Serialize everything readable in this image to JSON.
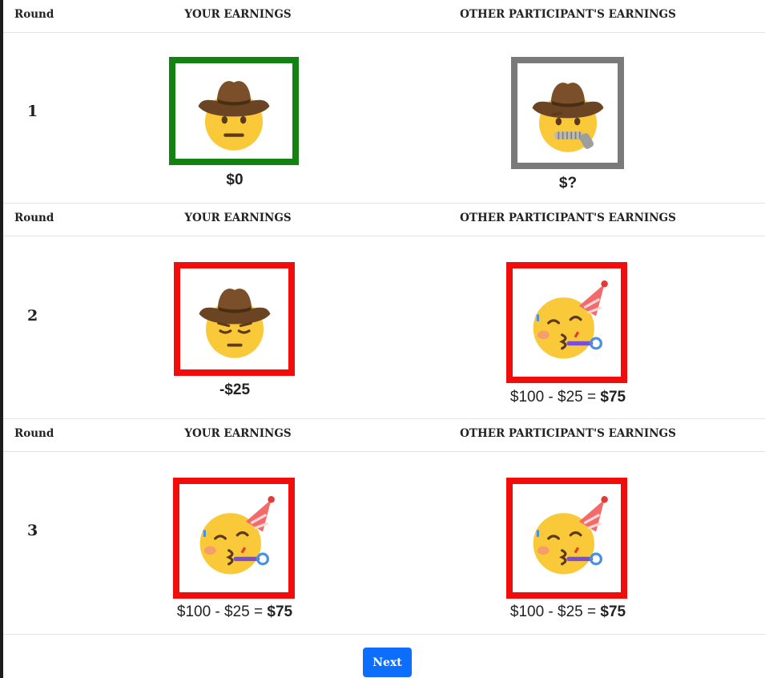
{
  "headers": {
    "round": "Round",
    "your_earnings": "YOUR EARNINGS",
    "other_earnings": "OTHER PARTICIPANT'S EARNINGS"
  },
  "rounds": [
    {
      "number": "1",
      "you": {
        "emoji": "cowboy-neutral-face-icon",
        "border_color": "#138213",
        "amount_prefix": "",
        "amount_bold": "$0"
      },
      "other": {
        "emoji": "cowboy-zipper-mouth-face-icon",
        "border_color": "#7a7a7a",
        "amount_prefix": "",
        "amount_bold": "$?"
      }
    },
    {
      "number": "2",
      "you": {
        "emoji": "cowboy-pensive-face-icon",
        "border_color": "#f20d0d",
        "amount_prefix": "",
        "amount_bold": "-$25"
      },
      "other": {
        "emoji": "partying-face-icon",
        "border_color": "#f20d0d",
        "amount_prefix": "$100 - $25 = ",
        "amount_bold": "$75"
      }
    },
    {
      "number": "3",
      "you": {
        "emoji": "partying-face-icon",
        "border_color": "#f20d0d",
        "amount_prefix": "$100 - $25 = ",
        "amount_bold": "$75"
      },
      "other": {
        "emoji": "partying-face-icon",
        "border_color": "#f20d0d",
        "amount_prefix": "$100 - $25 = ",
        "amount_bold": "$75"
      }
    }
  ],
  "next_button": {
    "label": "Next",
    "color": "#0d6efd"
  }
}
